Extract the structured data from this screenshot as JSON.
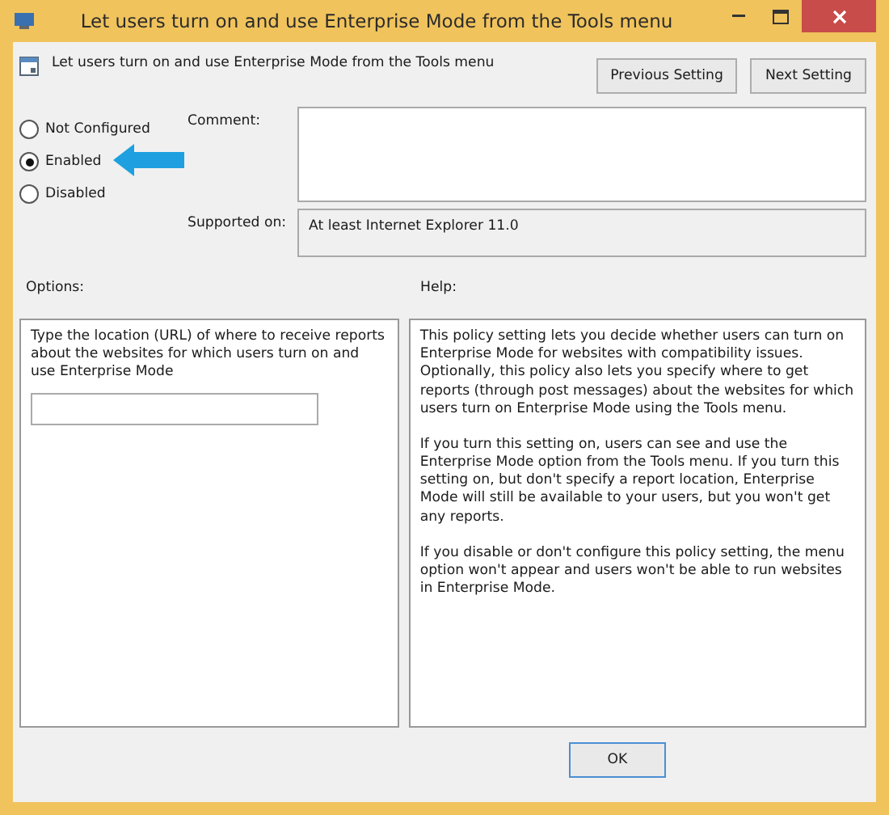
{
  "window": {
    "title": "Let users turn on and use Enterprise Mode from the Tools menu"
  },
  "header": {
    "setting_name": "Let users turn on and use Enterprise Mode from the Tools menu",
    "buttons": [
      "Previous Setting",
      "Next Setting"
    ]
  },
  "state_options": [
    {
      "label": "Not Configured",
      "selected": false
    },
    {
      "label": "Enabled",
      "selected": true
    },
    {
      "label": "Disabled",
      "selected": false
    }
  ],
  "comment": {
    "label": "Comment:"
  },
  "supported_on": {
    "label": "Supported on:",
    "value": "At least Internet Explorer 11.0"
  },
  "options": {
    "label": "Options:",
    "description": "Type the location (URL) of where to receive reports about the websites for which users turn on and use Enterprise Mode"
  },
  "help": {
    "label": "Help:",
    "paragraphs": [
      "This policy setting lets you decide whether users can turn on Enterprise Mode for websites with compatibility issues. Optionally, this policy also lets you specify where to get reports (through post messages) about the websites for which users turn on Enterprise Mode using the Tools menu.",
      "If you turn this setting on, users can see and use the Enterprise Mode option from the Tools menu. If you turn this setting on, but don't specify a report location, Enterprise Mode will still be available to your users, but you won't get any reports.",
      "If you disable or don't configure this policy setting, the menu option won't appear and users won't be able to run websites in Enterprise Mode."
    ]
  },
  "footer": {
    "buttons": [
      "OK"
    ]
  }
}
